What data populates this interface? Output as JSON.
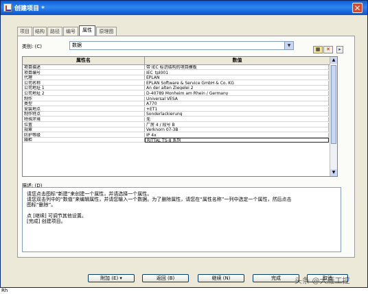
{
  "window": {
    "title": "创建项目 *"
  },
  "tabs": [
    "项目",
    "结构",
    "路径",
    "编号",
    "属性",
    "原理图"
  ],
  "category": {
    "label": "类别: (C)",
    "value": "数据"
  },
  "toolbar": {
    "new_icon": "new-property-icon",
    "delete_icon": "delete-property-icon",
    "move_icon": "move-right-icon"
  },
  "grid": {
    "headers": [
      "属性名",
      "数值"
    ],
    "rows": [
      {
        "name": "项目描述",
        "value": "带 IEC 标识结构的项目模板"
      },
      {
        "name": "项目编号",
        "value": "IEC_tpl001"
      },
      {
        "name": "代理",
        "value": "EPLAN"
      },
      {
        "name": "公司名称",
        "value": "EPLAN Software & Service GmbH & Co. KG"
      },
      {
        "name": "公司地址 1",
        "value": "An der alten Ziegelei 2"
      },
      {
        "name": "公司地址 2",
        "value": "D-40789 Monheim am Rhein / Germany"
      },
      {
        "name": "制作",
        "value": "Universal VESA"
      },
      {
        "name": "类型",
        "value": "A770"
      },
      {
        "name": "安装地点",
        "value": "+ET1"
      },
      {
        "name": "制作特点",
        "value": "Sonderlackierung"
      },
      {
        "name": "特殊环境",
        "value": "无"
      },
      {
        "name": "位置",
        "value": "厂房 4 / 段号 B"
      },
      {
        "name": "规章",
        "value": "Verknorn 07-3B"
      },
      {
        "name": "防护等级",
        "value": "IP 4x"
      },
      {
        "name": "箱柜",
        "value": "RITTAL TS-8 系列"
      }
    ]
  },
  "description": {
    "label": "描述: (D)",
    "lines": [
      "请您点击图标“新建”来创建一个属性，并请选择一个属性。",
      "请您双击列中的“数值”来编辑属性，并请您输入一个数据。为了删除属性，请您在“属性名称”一列中选定一个属性，然后点击",
      "图标“删除”。",
      "",
      "点 [继续] 可调节其他设置。",
      "[完成] 创建项目。"
    ]
  },
  "buttons": {
    "add": "附加 (E)",
    "back": "返回 (B)",
    "continue": "继续 (N)",
    "finish": "完成",
    "cancel": "取消"
  },
  "status_glyph": "Rh",
  "watermark": "头条 @大雁工控"
}
